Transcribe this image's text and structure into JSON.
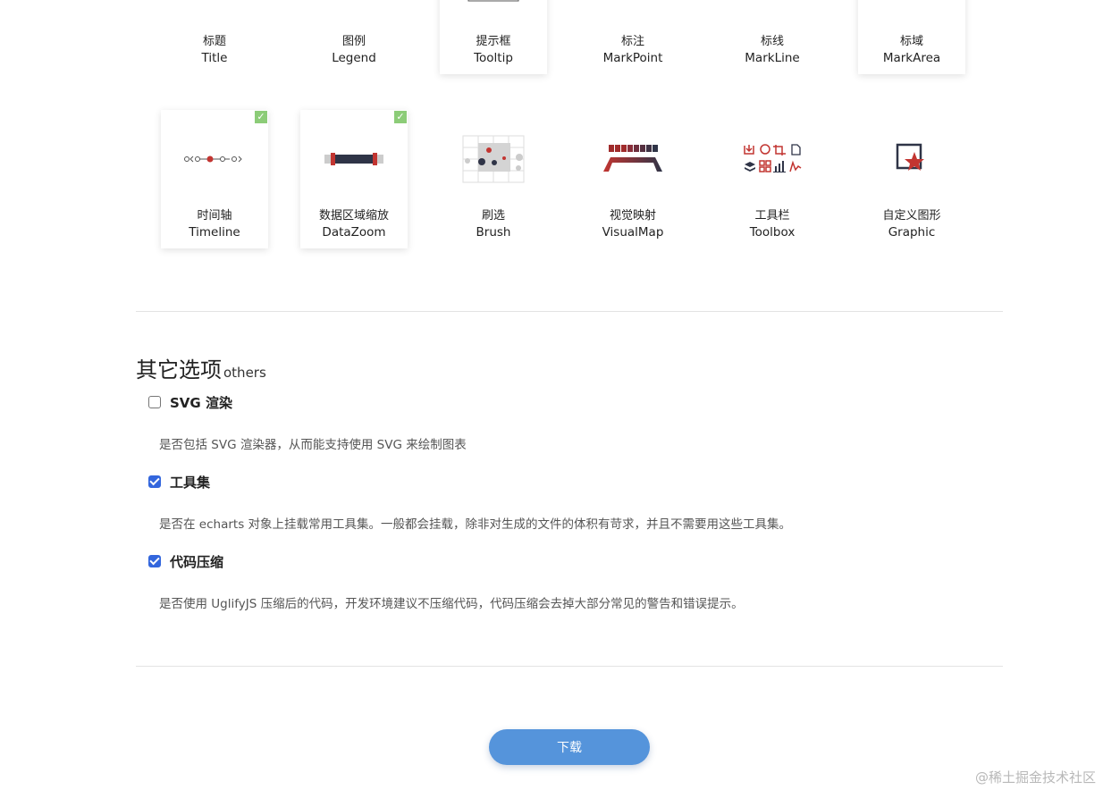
{
  "components_row1": [
    {
      "zh": "标题",
      "en": "Title",
      "selected": false,
      "icon": "title-icon"
    },
    {
      "zh": "图例",
      "en": "Legend",
      "selected": false,
      "icon": "legend-icon"
    },
    {
      "zh": "提示框",
      "en": "Tooltip",
      "selected": true,
      "icon": "tooltip-icon"
    },
    {
      "zh": "标注",
      "en": "MarkPoint",
      "selected": false,
      "icon": "markpoint-icon"
    },
    {
      "zh": "标线",
      "en": "MarkLine",
      "selected": false,
      "icon": "markline-icon"
    },
    {
      "zh": "标域",
      "en": "MarkArea",
      "selected": true,
      "icon": "markarea-icon"
    }
  ],
  "components_row2": [
    {
      "zh": "时间轴",
      "en": "Timeline",
      "selected": true,
      "icon": "timeline-icon"
    },
    {
      "zh": "数据区域缩放",
      "en": "DataZoom",
      "selected": true,
      "icon": "datazoom-icon"
    },
    {
      "zh": "刷选",
      "en": "Brush",
      "selected": false,
      "icon": "brush-icon"
    },
    {
      "zh": "视觉映射",
      "en": "VisualMap",
      "selected": false,
      "icon": "visualmap-icon"
    },
    {
      "zh": "工具栏",
      "en": "Toolbox",
      "selected": false,
      "icon": "toolbox-icon"
    },
    {
      "zh": "自定义图形",
      "en": "Graphic",
      "selected": false,
      "icon": "graphic-icon"
    }
  ],
  "others": {
    "title": "其它选项",
    "subtitle": "others",
    "options": [
      {
        "label": "SVG 渲染",
        "checked": false,
        "desc": "是否包括 SVG 渲染器，从而能支持使用 SVG 来绘制图表"
      },
      {
        "label": "工具集",
        "checked": true,
        "desc": "是否在 echarts 对象上挂载常用工具集。一般都会挂载，除非对生成的文件的体积有苛求，并且不需要用这些工具集。"
      },
      {
        "label": "代码压缩",
        "checked": true,
        "desc": "是否使用 UglifyJS 压缩后的代码，开发环境建议不压缩代码，代码压缩会去掉大部分常见的警告和错误提示。"
      }
    ]
  },
  "download_label": "下载",
  "watermark": "@稀土掘金技术社区",
  "colors": {
    "accent": "#5594db",
    "check_green": "#8ccc78",
    "icon_red": "#c23531",
    "icon_dark": "#2f3447"
  }
}
